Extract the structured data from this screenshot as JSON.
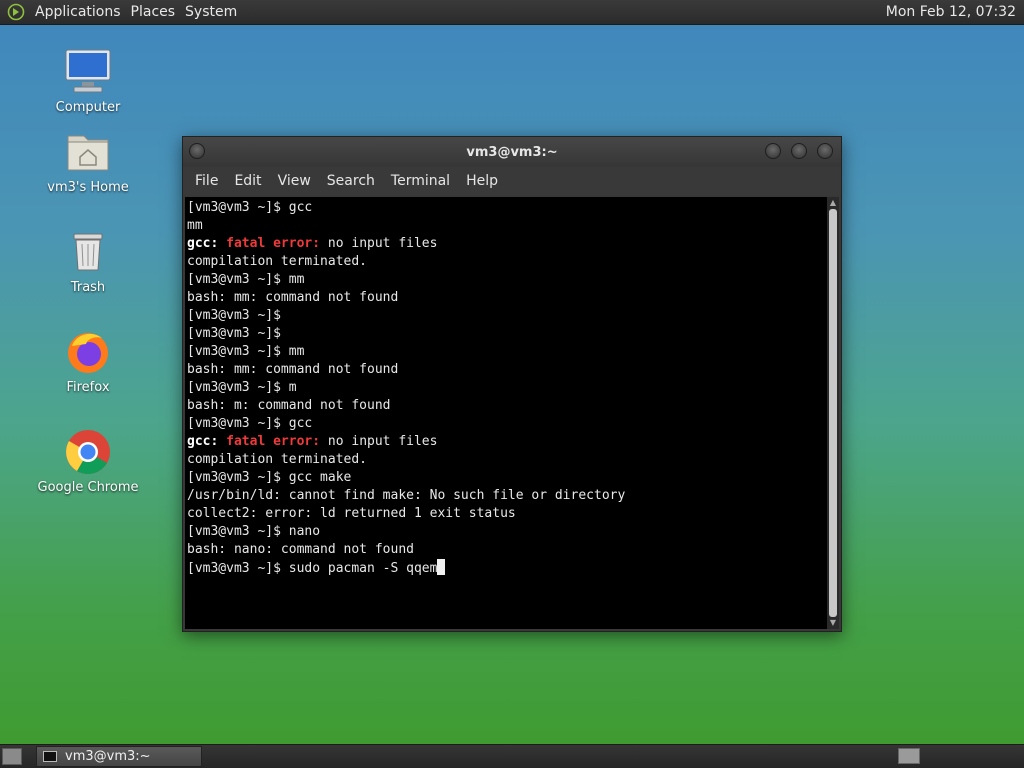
{
  "top_panel": {
    "menus": [
      "Applications",
      "Places",
      "System"
    ],
    "clock": "Mon Feb 12, 07:32"
  },
  "desktop_icons": [
    {
      "label": "Computer",
      "icon": "computer-icon"
    },
    {
      "label": "vm3's Home",
      "icon": "home-folder-icon"
    },
    {
      "label": "Trash",
      "icon": "trash-icon"
    },
    {
      "label": "Firefox",
      "icon": "firefox-icon"
    },
    {
      "label": "Google Chrome",
      "icon": "chrome-icon"
    }
  ],
  "terminal": {
    "title": "vm3@vm3:~",
    "menu": [
      "File",
      "Edit",
      "View",
      "Search",
      "Terminal",
      "Help"
    ],
    "lines": [
      "[vm3@vm3 ~]$ gcc",
      "mm",
      "gcc: fatal error: no input files",
      "compilation terminated.",
      "[vm3@vm3 ~]$ mm",
      "bash: mm: command not found",
      "[vm3@vm3 ~]$",
      "[vm3@vm3 ~]$",
      "[vm3@vm3 ~]$ mm",
      "bash: mm: command not found",
      "[vm3@vm3 ~]$ m",
      "bash: m: command not found",
      "[vm3@vm3 ~]$ gcc",
      "gcc: fatal error: no input files",
      "compilation terminated.",
      "[vm3@vm3 ~]$ gcc make",
      "/usr/bin/ld: cannot find make: No such file or directory",
      "collect2: error: ld returned 1 exit status",
      "[vm3@vm3 ~]$ nano",
      "bash: nano: command not found",
      "[vm3@vm3 ~]$ sudo pacman -S qqem"
    ]
  },
  "taskbar": {
    "window_label": "vm3@vm3:~"
  },
  "colors": {
    "error_red": "#ef3a3a",
    "terminal_bg": "#000000"
  }
}
